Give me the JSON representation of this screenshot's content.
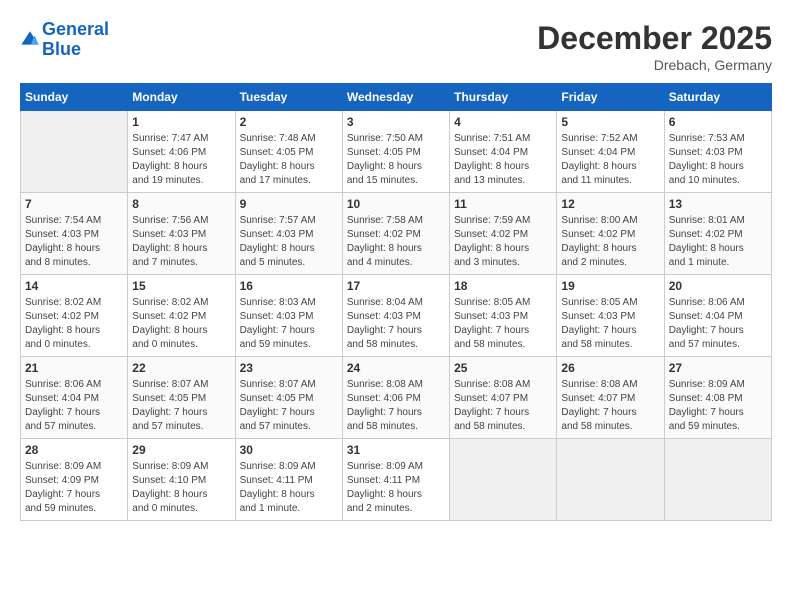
{
  "header": {
    "logo_line1": "General",
    "logo_line2": "Blue",
    "month_title": "December 2025",
    "location": "Drebach, Germany"
  },
  "columns": [
    "Sunday",
    "Monday",
    "Tuesday",
    "Wednesday",
    "Thursday",
    "Friday",
    "Saturday"
  ],
  "weeks": [
    [
      {
        "day": "",
        "info": ""
      },
      {
        "day": "1",
        "info": "Sunrise: 7:47 AM\nSunset: 4:06 PM\nDaylight: 8 hours\nand 19 minutes."
      },
      {
        "day": "2",
        "info": "Sunrise: 7:48 AM\nSunset: 4:05 PM\nDaylight: 8 hours\nand 17 minutes."
      },
      {
        "day": "3",
        "info": "Sunrise: 7:50 AM\nSunset: 4:05 PM\nDaylight: 8 hours\nand 15 minutes."
      },
      {
        "day": "4",
        "info": "Sunrise: 7:51 AM\nSunset: 4:04 PM\nDaylight: 8 hours\nand 13 minutes."
      },
      {
        "day": "5",
        "info": "Sunrise: 7:52 AM\nSunset: 4:04 PM\nDaylight: 8 hours\nand 11 minutes."
      },
      {
        "day": "6",
        "info": "Sunrise: 7:53 AM\nSunset: 4:03 PM\nDaylight: 8 hours\nand 10 minutes."
      }
    ],
    [
      {
        "day": "7",
        "info": "Sunrise: 7:54 AM\nSunset: 4:03 PM\nDaylight: 8 hours\nand 8 minutes."
      },
      {
        "day": "8",
        "info": "Sunrise: 7:56 AM\nSunset: 4:03 PM\nDaylight: 8 hours\nand 7 minutes."
      },
      {
        "day": "9",
        "info": "Sunrise: 7:57 AM\nSunset: 4:03 PM\nDaylight: 8 hours\nand 5 minutes."
      },
      {
        "day": "10",
        "info": "Sunrise: 7:58 AM\nSunset: 4:02 PM\nDaylight: 8 hours\nand 4 minutes."
      },
      {
        "day": "11",
        "info": "Sunrise: 7:59 AM\nSunset: 4:02 PM\nDaylight: 8 hours\nand 3 minutes."
      },
      {
        "day": "12",
        "info": "Sunrise: 8:00 AM\nSunset: 4:02 PM\nDaylight: 8 hours\nand 2 minutes."
      },
      {
        "day": "13",
        "info": "Sunrise: 8:01 AM\nSunset: 4:02 PM\nDaylight: 8 hours\nand 1 minute."
      }
    ],
    [
      {
        "day": "14",
        "info": "Sunrise: 8:02 AM\nSunset: 4:02 PM\nDaylight: 8 hours\nand 0 minutes."
      },
      {
        "day": "15",
        "info": "Sunrise: 8:02 AM\nSunset: 4:02 PM\nDaylight: 8 hours\nand 0 minutes."
      },
      {
        "day": "16",
        "info": "Sunrise: 8:03 AM\nSunset: 4:03 PM\nDaylight: 7 hours\nand 59 minutes."
      },
      {
        "day": "17",
        "info": "Sunrise: 8:04 AM\nSunset: 4:03 PM\nDaylight: 7 hours\nand 58 minutes."
      },
      {
        "day": "18",
        "info": "Sunrise: 8:05 AM\nSunset: 4:03 PM\nDaylight: 7 hours\nand 58 minutes."
      },
      {
        "day": "19",
        "info": "Sunrise: 8:05 AM\nSunset: 4:03 PM\nDaylight: 7 hours\nand 58 minutes."
      },
      {
        "day": "20",
        "info": "Sunrise: 8:06 AM\nSunset: 4:04 PM\nDaylight: 7 hours\nand 57 minutes."
      }
    ],
    [
      {
        "day": "21",
        "info": "Sunrise: 8:06 AM\nSunset: 4:04 PM\nDaylight: 7 hours\nand 57 minutes."
      },
      {
        "day": "22",
        "info": "Sunrise: 8:07 AM\nSunset: 4:05 PM\nDaylight: 7 hours\nand 57 minutes."
      },
      {
        "day": "23",
        "info": "Sunrise: 8:07 AM\nSunset: 4:05 PM\nDaylight: 7 hours\nand 57 minutes."
      },
      {
        "day": "24",
        "info": "Sunrise: 8:08 AM\nSunset: 4:06 PM\nDaylight: 7 hours\nand 58 minutes."
      },
      {
        "day": "25",
        "info": "Sunrise: 8:08 AM\nSunset: 4:07 PM\nDaylight: 7 hours\nand 58 minutes."
      },
      {
        "day": "26",
        "info": "Sunrise: 8:08 AM\nSunset: 4:07 PM\nDaylight: 7 hours\nand 58 minutes."
      },
      {
        "day": "27",
        "info": "Sunrise: 8:09 AM\nSunset: 4:08 PM\nDaylight: 7 hours\nand 59 minutes."
      }
    ],
    [
      {
        "day": "28",
        "info": "Sunrise: 8:09 AM\nSunset: 4:09 PM\nDaylight: 7 hours\nand 59 minutes."
      },
      {
        "day": "29",
        "info": "Sunrise: 8:09 AM\nSunset: 4:10 PM\nDaylight: 8 hours\nand 0 minutes."
      },
      {
        "day": "30",
        "info": "Sunrise: 8:09 AM\nSunset: 4:11 PM\nDaylight: 8 hours\nand 1 minute."
      },
      {
        "day": "31",
        "info": "Sunrise: 8:09 AM\nSunset: 4:11 PM\nDaylight: 8 hours\nand 2 minutes."
      },
      {
        "day": "",
        "info": ""
      },
      {
        "day": "",
        "info": ""
      },
      {
        "day": "",
        "info": ""
      }
    ]
  ]
}
